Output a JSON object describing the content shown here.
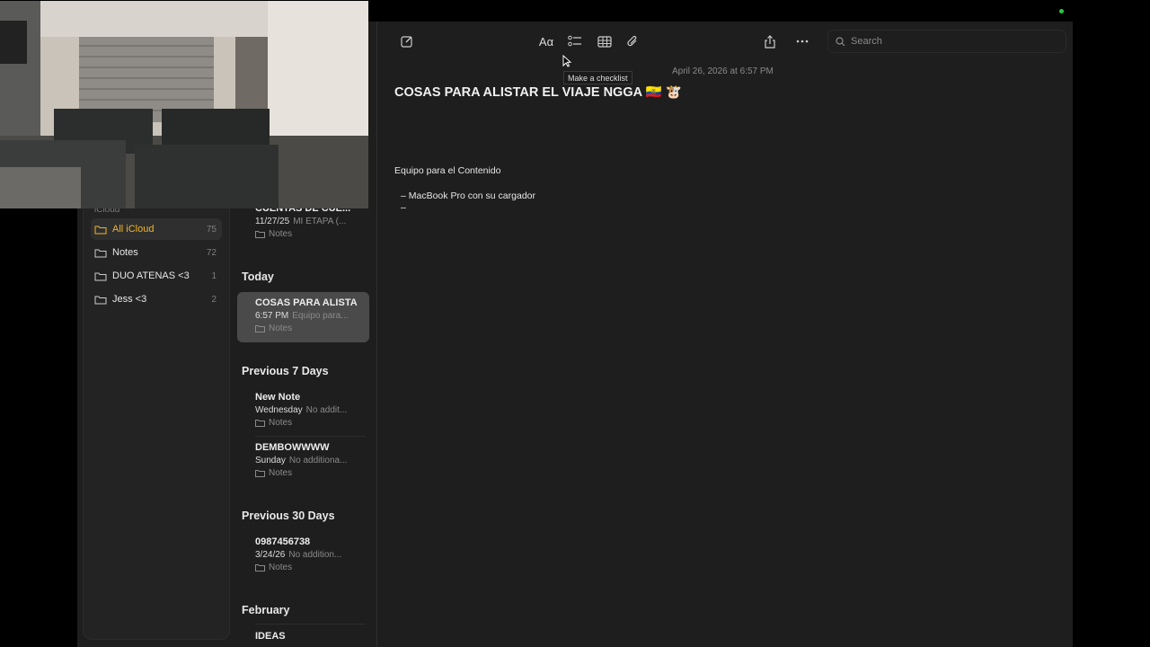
{
  "sidebar": {
    "section": "iCloud",
    "folders": [
      {
        "label": "All iCloud",
        "count": "75",
        "selected": true
      },
      {
        "label": "Notes",
        "count": "72"
      },
      {
        "label": "DUO ATENAS <3",
        "count": "1"
      },
      {
        "label": "Jess <3",
        "count": "2"
      }
    ]
  },
  "notes_list": {
    "top_note": {
      "title": "CUENTAS DE CUE...",
      "date": "11/27/25",
      "preview": "MI ETAPA (...",
      "folder": "Notes"
    },
    "groups": [
      {
        "header": "Today",
        "notes": [
          {
            "title": "COSAS PARA ALISTA",
            "date": "6:57 PM",
            "preview": "Equipo para...",
            "folder": "Notes"
          }
        ]
      },
      {
        "header": "Previous 7 Days",
        "notes": [
          {
            "title": "New Note",
            "date": "Wednesday",
            "preview": "No addit...",
            "folder": "Notes"
          },
          {
            "title": "DEMBOWWWW",
            "date": "Sunday",
            "preview": "No additiona...",
            "folder": "Notes"
          }
        ]
      },
      {
        "header": "Previous 30 Days",
        "notes": [
          {
            "title": "0987456738",
            "date": "3/24/26",
            "preview": "No addition...",
            "folder": "Notes"
          }
        ]
      },
      {
        "header": "February",
        "notes": [
          {
            "title": "IDEAS"
          }
        ]
      }
    ]
  },
  "toolbar": {
    "format_label": "Aα",
    "search_placeholder": "Search",
    "tooltip": "Make a checklist"
  },
  "editor": {
    "date": "April 26, 2026 at 6:57 PM",
    "title": "COSAS PARA ALISTAR EL VIAJE NGGA 🇪🇨 🐮",
    "line1": "Equipo para el Contenido",
    "bullets": [
      "–  MacBook Pro con su cargador",
      "–"
    ]
  },
  "colors": {
    "accent": "#f0b429",
    "status_dot": "#27c93f"
  }
}
